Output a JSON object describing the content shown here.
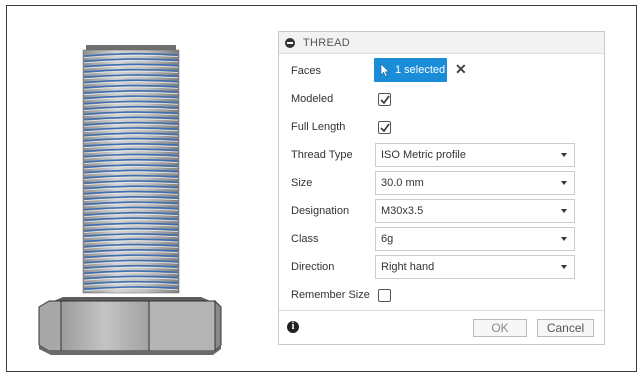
{
  "dialog": {
    "title": "THREAD",
    "icons": {
      "header": "collapse-icon",
      "info": "info-icon",
      "cursor": "cursor-icon",
      "clear": "close-icon",
      "dropdown": "chevron-down-icon"
    },
    "accent_color": "#1a8cd8",
    "faces": {
      "label": "Faces",
      "button_label": "1 selected",
      "clear_symbol": "✕"
    },
    "modeled": {
      "label": "Modeled",
      "checked": true
    },
    "full_length": {
      "label": "Full Length",
      "checked": true
    },
    "thread_type": {
      "label": "Thread Type",
      "value": "ISO Metric profile"
    },
    "size": {
      "label": "Size",
      "value": "30.0 mm"
    },
    "designation": {
      "label": "Designation",
      "value": "M30x3.5"
    },
    "class": {
      "label": "Class",
      "value": "6g"
    },
    "direction": {
      "label": "Direction",
      "value": "Right hand"
    },
    "remember_size": {
      "label": "Remember Size",
      "checked": false
    },
    "info_symbol": "i",
    "ok_label": "OK",
    "cancel_label": "Cancel"
  },
  "model": {
    "name": "hex-bolt",
    "thread_color": "#3f6fb0",
    "body_color": "#b8b8b8"
  }
}
